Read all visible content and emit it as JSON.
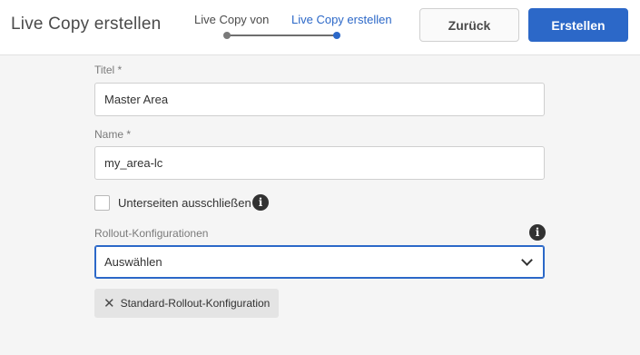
{
  "header": {
    "title": "Live Copy erstellen",
    "steps": [
      {
        "label": "Live Copy von",
        "state": "done"
      },
      {
        "label": "Live Copy erstellen",
        "state": "active"
      }
    ],
    "back_label": "Zurück",
    "create_label": "Erstellen"
  },
  "form": {
    "title_label": "Titel *",
    "title_value": "Master Area",
    "name_label": "Name *",
    "name_value": "my_area-lc",
    "exclude_subpages_label": "Unterseiten ausschließen",
    "exclude_subpages_checked": false,
    "rollout_label": "Rollout-Konfigurationen",
    "rollout_placeholder": "Auswählen",
    "selected_configs": [
      {
        "label": "Standard-Rollout-Konfiguration",
        "remove_symbol": "✕"
      }
    ],
    "info_symbol": "i"
  },
  "colors": {
    "accent": "#2c68c8",
    "background": "#f5f5f5",
    "header": "#ffffff",
    "tag": "#e4e4e4"
  },
  "icons": {
    "info": "info-icon",
    "dropdown": "chevron-down-icon",
    "remove": "close-icon"
  }
}
